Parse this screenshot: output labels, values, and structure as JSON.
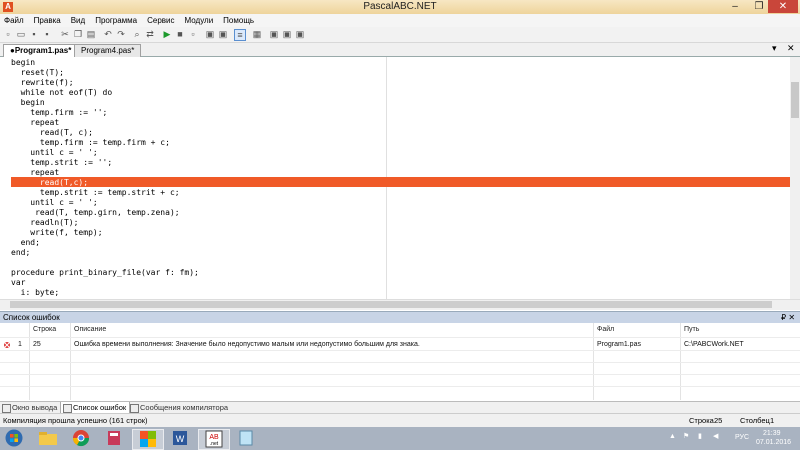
{
  "window": {
    "title": "PascalABC.NET",
    "minimize": "–",
    "maximize": "❐",
    "close": "✕"
  },
  "menu": [
    "Файл",
    "Правка",
    "Вид",
    "Программа",
    "Сервис",
    "Модули",
    "Помощь"
  ],
  "tabs": [
    {
      "label": "●Program1.pas*",
      "active": true
    },
    {
      "label": "Program4.pas*",
      "active": false
    }
  ],
  "tab_controls": {
    "dropdown": "▾",
    "close": "✕"
  },
  "code_lines": [
    "begin",
    "  reset(T);",
    "  rewrite(f);",
    "  while not eof(T) do",
    "  begin",
    "    temp.firm := '';",
    "    repeat",
    "      read(T, c);",
    "      temp.firm := temp.firm + c;",
    "    until c = ' ';",
    "    temp.strit := '';",
    "    repeat",
    "      read(T,c);",
    "      temp.strit := temp.strit + c;",
    "    until c = ' ';",
    "     read(T, temp.girn, temp.zena);",
    "    readln(T);",
    "    write(f, temp);",
    "  end;",
    "end;",
    "",
    "procedure print_binary_file(var f: fm);",
    "var",
    "  i: byte;"
  ],
  "highlight_line": 12,
  "error_panel": {
    "title": "Список ошибок",
    "pin": "₽ ✕",
    "columns": {
      "line": "Строка",
      "description": "Описание",
      "file": "Файл",
      "path": "Путь"
    },
    "rows": [
      {
        "index": "1",
        "line": "25",
        "description": "Ошибка времени выполнения: Значение было недопустимо малым или недопустимо большим для знака.",
        "file": "Program1.pas",
        "path": "C:\\PABCWork.NET"
      }
    ]
  },
  "bottom_tabs": [
    {
      "label": "Окно вывода",
      "active": false
    },
    {
      "label": "Список ошибок",
      "active": true
    },
    {
      "label": "Сообщения компилятора",
      "active": false
    }
  ],
  "status": {
    "message": "Компиляция прошла успешно (161 строк)",
    "line_label": "Строка",
    "line_value": "25",
    "column_label": "Столбец",
    "column_value": "1"
  },
  "taskbar": {
    "language": "РУС",
    "time": "21:39",
    "date": "07.01.2016"
  },
  "colors": {
    "highlight": "#f05a28",
    "titlebar": "#f0d8a0"
  }
}
